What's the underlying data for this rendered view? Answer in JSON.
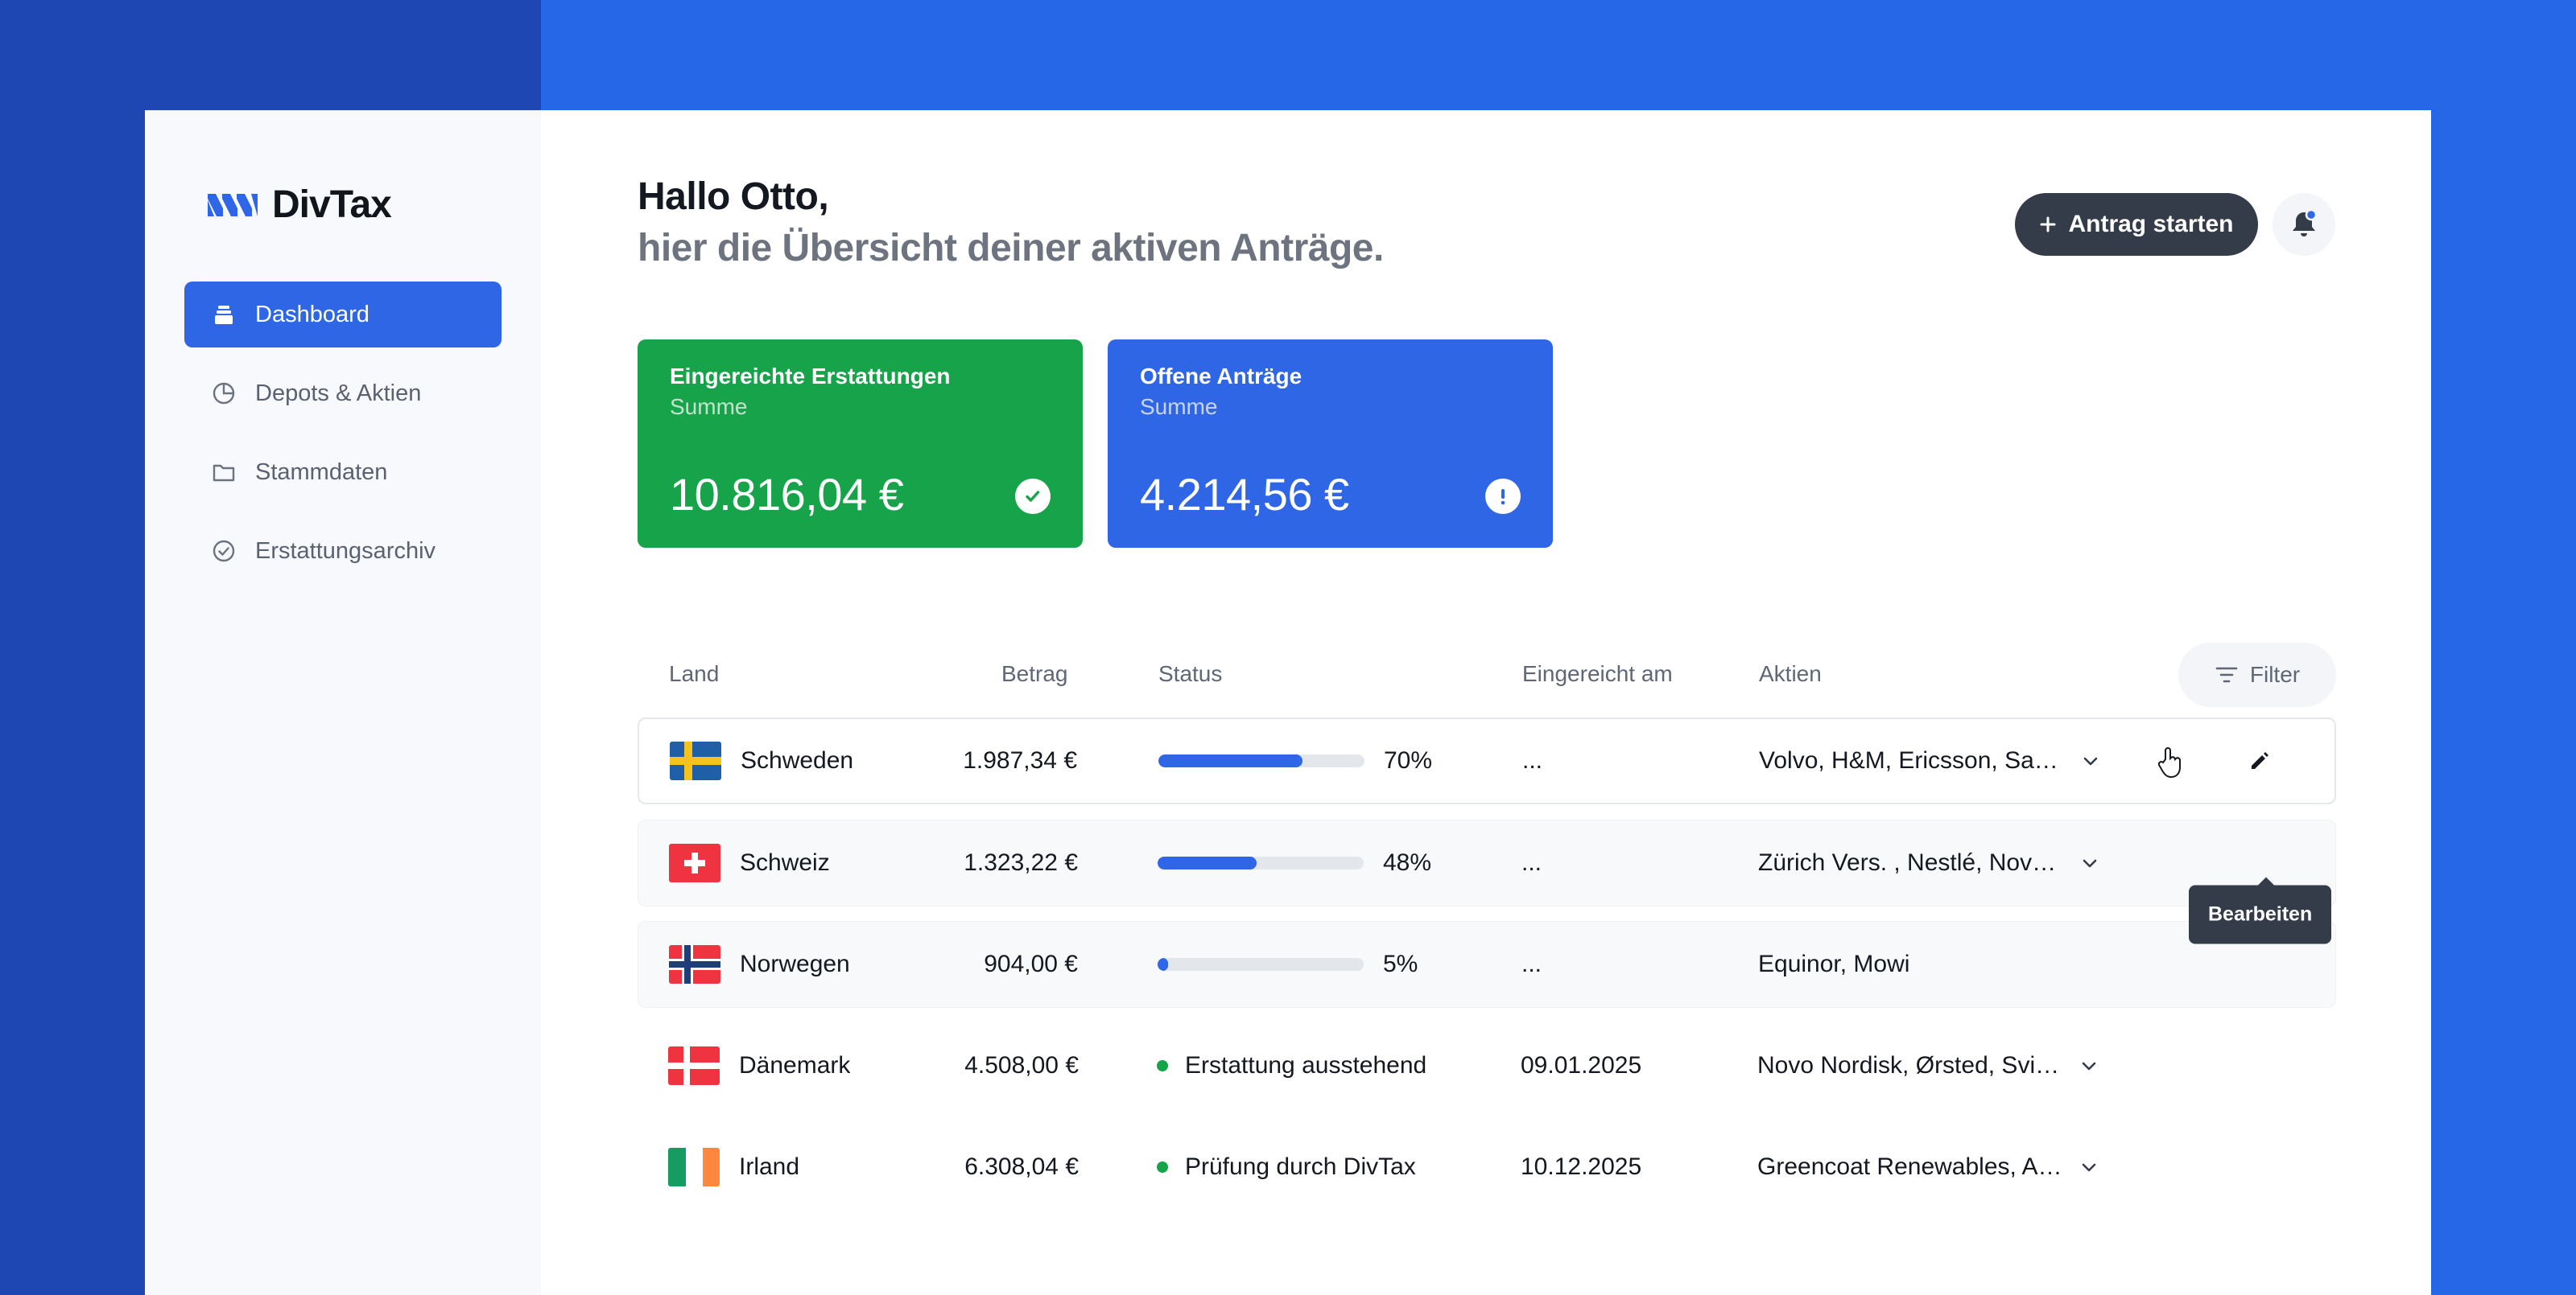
{
  "app": {
    "name": "DivTax"
  },
  "colors": {
    "primary": "#2f66e6",
    "green": "#17a34a",
    "dark": "#343b49",
    "background": "#2667e8"
  },
  "sidebar": {
    "items": [
      {
        "label": "Dashboard",
        "icon": "stack-icon",
        "active": true
      },
      {
        "label": "Depots & Aktien",
        "icon": "pie-chart-icon",
        "active": false
      },
      {
        "label": "Stammdaten",
        "icon": "folder-icon",
        "active": false
      },
      {
        "label": "Erstattungsarchiv",
        "icon": "check-circle-icon",
        "active": false
      }
    ]
  },
  "header": {
    "greeting": "Hallo Otto,",
    "subtitle": "hier die Übersicht deiner aktiven Anträge.",
    "start_button": "Antrag starten",
    "notification_icon": "bell-icon"
  },
  "cards": [
    {
      "title": "Eingereichte Erstattungen",
      "subtitle": "Summe",
      "value": "10.816,04 €",
      "icon": "check-circle-icon",
      "color": "#17a34a"
    },
    {
      "title": "Offene Anträge",
      "subtitle": "Summe",
      "value": "4.214,56 €",
      "icon": "exclamation-circle-icon",
      "color": "#2f66e6"
    }
  ],
  "table": {
    "headers": {
      "country": "Land",
      "amount": "Betrag",
      "status": "Status",
      "submitted": "Eingereicht am",
      "stocks": "Aktien"
    },
    "filter_label": "Filter",
    "tooltip": "Bearbeiten",
    "rows": [
      {
        "country": "Schweden",
        "flag": "sweden",
        "amount": "1.987,34 €",
        "progress": 70,
        "progress_label": "70%",
        "submitted": "...",
        "stocks": "Volvo, H&M, Ericsson, Sandv...",
        "expandable": true
      },
      {
        "country": "Schweiz",
        "flag": "switzerland",
        "amount": "1.323,22 €",
        "progress": 48,
        "progress_label": "48%",
        "submitted": "...",
        "stocks": "Zürich Vers. , Nestlé, Novarti...",
        "expandable": true
      },
      {
        "country": "Norwegen",
        "flag": "norway",
        "amount": "904,00 €",
        "progress": 5,
        "progress_label": "5%",
        "submitted": "...",
        "stocks": "Equinor, Mowi",
        "expandable": false
      },
      {
        "country": "Dänemark",
        "flag": "denmark",
        "amount": "4.508,00 €",
        "status": "Erstattung ausstehend",
        "submitted": "09.01.2025",
        "stocks": "Novo Nordisk, Ørsted, Svitz...",
        "expandable": true
      },
      {
        "country": "Irland",
        "flag": "ireland",
        "amount": "6.308,04 €",
        "status": "Prüfung durch DivTax",
        "submitted": "10.12.2025",
        "stocks": "Greencoat Renewables, Ac...",
        "expandable": true
      }
    ]
  }
}
